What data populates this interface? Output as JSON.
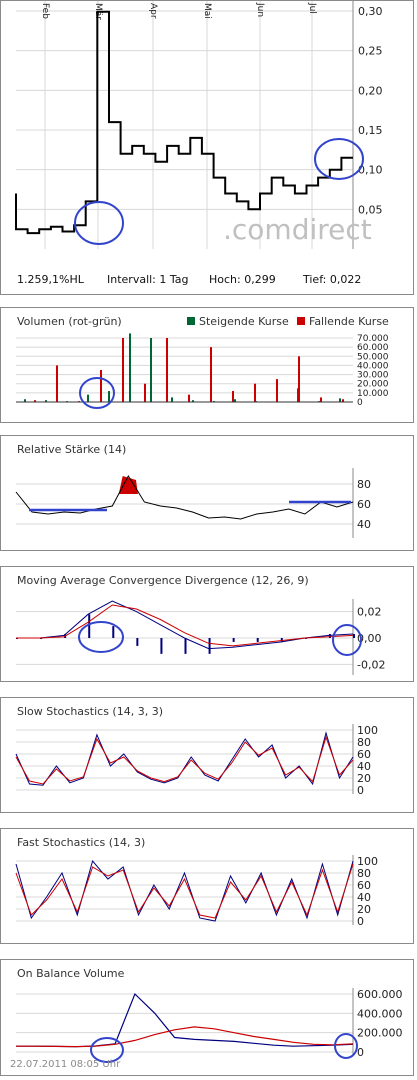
{
  "colors": {
    "price": "#000000",
    "volume_up": "#006633",
    "volume_down": "#cc0000",
    "rsi_fill": "#cc0000",
    "ma_red": "#cc0000",
    "line_blue": "#000080",
    "circle": "#3344cc",
    "grid": "#d8d8d8",
    "watermark": "#c0c0c0"
  },
  "main": {
    "months": [
      "Feb",
      "Mär",
      "Apr",
      "Mai",
      "Jun",
      "Jul"
    ],
    "yticks": [
      "0,30",
      "0,25",
      "0,20",
      "0,15",
      "0,10",
      "0,05"
    ],
    "watermark": ".comdirect",
    "stats": {
      "change": "1.259,1%HL",
      "interval": "Intervall: 1 Tag",
      "high": "Hoch:  0,299",
      "low": "Tief:  0,022"
    }
  },
  "volume": {
    "title": "Volumen (rot-grün)",
    "legend_up": "Steigende Kurse",
    "legend_down": "Fallende Kurse",
    "yticks": [
      "70.000",
      "60.000",
      "50.000",
      "40.000",
      "30.000",
      "20.000",
      "10.000",
      "0"
    ]
  },
  "rsi": {
    "title": "Relative Stärke (14)",
    "yticks": [
      "80",
      "60",
      "40"
    ]
  },
  "macd": {
    "title": "Moving Average Convergence Divergence (12, 26, 9)",
    "yticks": [
      "0,02",
      "0,00",
      "-0,02"
    ]
  },
  "slowsto": {
    "title": "Slow Stochastics (14, 3, 3)",
    "yticks": [
      "100",
      "80",
      "60",
      "40",
      "20",
      "0"
    ]
  },
  "faststo": {
    "title": "Fast Stochastics (14, 3)",
    "yticks": [
      "100",
      "80",
      "60",
      "40",
      "20",
      "0"
    ]
  },
  "obv": {
    "title": "On Balance Volume",
    "yticks": [
      "600.000",
      "400.000",
      "200.000",
      "0"
    ],
    "timestamp": "22.07.2011 08:05 Uhr"
  },
  "chart_data": [
    {
      "type": "line",
      "title": "",
      "x": [
        "Feb",
        "Mär",
        "Apr",
        "Mai",
        "Jun",
        "Jul"
      ],
      "series": [
        {
          "values": [
            0.07,
            0.025,
            0.02,
            0.025,
            0.028,
            0.022,
            0.03,
            0.06,
            0.299,
            0.16,
            0.12,
            0.13,
            0.12,
            0.11,
            0.13,
            0.12,
            0.14,
            0.12,
            0.09,
            0.07,
            0.06,
            0.05,
            0.07,
            0.09,
            0.08,
            0.07,
            0.08,
            0.09,
            0.1,
            0.115
          ]
        }
      ],
      "ylim": [
        0,
        0.3
      ]
    },
    {
      "type": "bar",
      "title": "Volumen (rot-grün)",
      "series": [
        {
          "name": "Steigende Kurse",
          "values": [
            3000,
            2000,
            1000,
            8000,
            12000,
            75000,
            70000,
            5000,
            2000,
            1000,
            3000,
            1000,
            2000,
            15000,
            1000,
            4000
          ]
        },
        {
          "name": "Fallende Kurse",
          "values": [
            2000,
            40000,
            1000,
            35000,
            70000,
            20000,
            70000,
            8000,
            60000,
            12000,
            20000,
            25000,
            50000,
            5000,
            3000
          ]
        }
      ],
      "ylim": [
        0,
        70000
      ]
    },
    {
      "type": "line",
      "title": "Relative Stärke (14)",
      "series": [
        {
          "values": [
            72,
            52,
            50,
            52,
            51,
            55,
            58,
            88,
            62,
            58,
            56,
            52,
            46,
            47,
            45,
            50,
            52,
            55,
            50,
            62,
            57,
            62
          ]
        }
      ],
      "ylim": [
        30,
        90
      ]
    },
    {
      "type": "line",
      "title": "Moving Average Convergence Divergence (12, 26, 9)",
      "series": [
        {
          "values": [
            0,
            0,
            0.002,
            0.018,
            0.028,
            0.02,
            0.01,
            0.0,
            -0.008,
            -0.007,
            -0.005,
            -0.003,
            0,
            0.002,
            0.003
          ]
        },
        {
          "values": [
            0,
            0,
            0.001,
            0.012,
            0.025,
            0.022,
            0.014,
            0.004,
            -0.004,
            -0.006,
            -0.004,
            -0.002,
            0,
            0.001,
            0.002
          ]
        }
      ],
      "ylim": [
        -0.025,
        0.025
      ]
    },
    {
      "type": "line",
      "title": "Slow Stochastics (14, 3, 3)",
      "series": [
        {
          "values": [
            60,
            10,
            8,
            40,
            12,
            20,
            92,
            40,
            60,
            30,
            18,
            12,
            20,
            55,
            25,
            15,
            50,
            85,
            55,
            75,
            20,
            40,
            10,
            95,
            20,
            55
          ]
        },
        {
          "values": [
            55,
            15,
            10,
            35,
            15,
            22,
            85,
            45,
            55,
            32,
            20,
            14,
            22,
            50,
            28,
            18,
            45,
            80,
            58,
            70,
            25,
            38,
            14,
            88,
            25,
            50
          ]
        }
      ],
      "ylim": [
        0,
        100
      ]
    },
    {
      "type": "line",
      "title": "Fast Stochastics (14, 3)",
      "series": [
        {
          "values": [
            95,
            5,
            40,
            80,
            10,
            100,
            70,
            90,
            10,
            60,
            20,
            80,
            5,
            0,
            75,
            30,
            80,
            10,
            70,
            5,
            95,
            10,
            100
          ]
        },
        {
          "values": [
            80,
            10,
            35,
            70,
            15,
            90,
            75,
            85,
            15,
            55,
            25,
            70,
            10,
            5,
            65,
            35,
            75,
            15,
            65,
            10,
            85,
            15,
            95
          ]
        }
      ],
      "ylim": [
        0,
        100
      ]
    },
    {
      "type": "line",
      "title": "On Balance Volume",
      "series": [
        {
          "values": [
            60000,
            60000,
            58000,
            55000,
            62000,
            85000,
            600000,
            400000,
            150000,
            130000,
            120000,
            110000,
            90000,
            70000,
            60000,
            65000,
            70000,
            80000
          ]
        },
        {
          "values": [
            60000,
            60000,
            58000,
            56000,
            60000,
            80000,
            120000,
            180000,
            230000,
            260000,
            240000,
            200000,
            160000,
            130000,
            100000,
            80000,
            75000,
            85000
          ]
        }
      ],
      "ylim": [
        0,
        600000
      ]
    }
  ]
}
